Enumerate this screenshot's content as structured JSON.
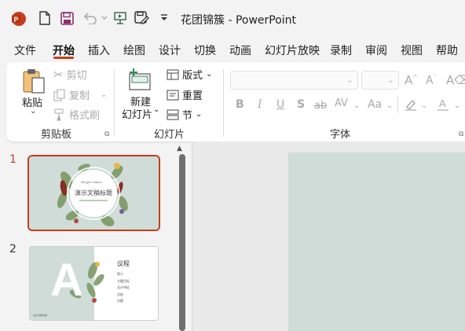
{
  "app": {
    "logo_letter": "P",
    "window_title": "花团锦簇  -  PowerPoint"
  },
  "quick_access": [
    "new-file-icon",
    "save-icon",
    "undo-icon",
    "present-icon",
    "save-as-icon",
    "customize-icon"
  ],
  "menu": {
    "tabs": [
      "文件",
      "开始",
      "插入",
      "绘图",
      "设计",
      "切换",
      "动画",
      "幻灯片放映",
      "录制",
      "审阅",
      "视图",
      "帮助"
    ],
    "active": "开始"
  },
  "ribbon": {
    "clipboard": {
      "paste": "粘贴",
      "cut": "剪切",
      "copy": "复制",
      "format_painter": "格式刷",
      "group_label": "剪贴板"
    },
    "slides": {
      "new_slide_line1": "新建",
      "new_slide_line2": "幻灯片",
      "layout": "版式",
      "reset": "重置",
      "section": "节",
      "group_label": "幻灯片"
    },
    "font": {
      "font_name": "",
      "font_size": "",
      "bold": "B",
      "italic": "I",
      "underline": "U",
      "shadow": "S",
      "strike": "ab",
      "spacing": "AV",
      "change_case": "Aa",
      "group_label": "字体"
    }
  },
  "slides": [
    {
      "number": "1",
      "selected": true,
      "subtitle": "Mingxin Nature",
      "title": "演示文稿标题"
    },
    {
      "number": "2",
      "selected": false,
      "big_letter": "A",
      "heading": "议程",
      "items": [
        "简介",
        "主题目标",
        "设计特征",
        "总结",
        "问题"
      ],
      "footer": "演示文稿标题"
    }
  ],
  "colors": {
    "accent": "#c43e1c",
    "slide_bg": "#cfdcd7"
  }
}
